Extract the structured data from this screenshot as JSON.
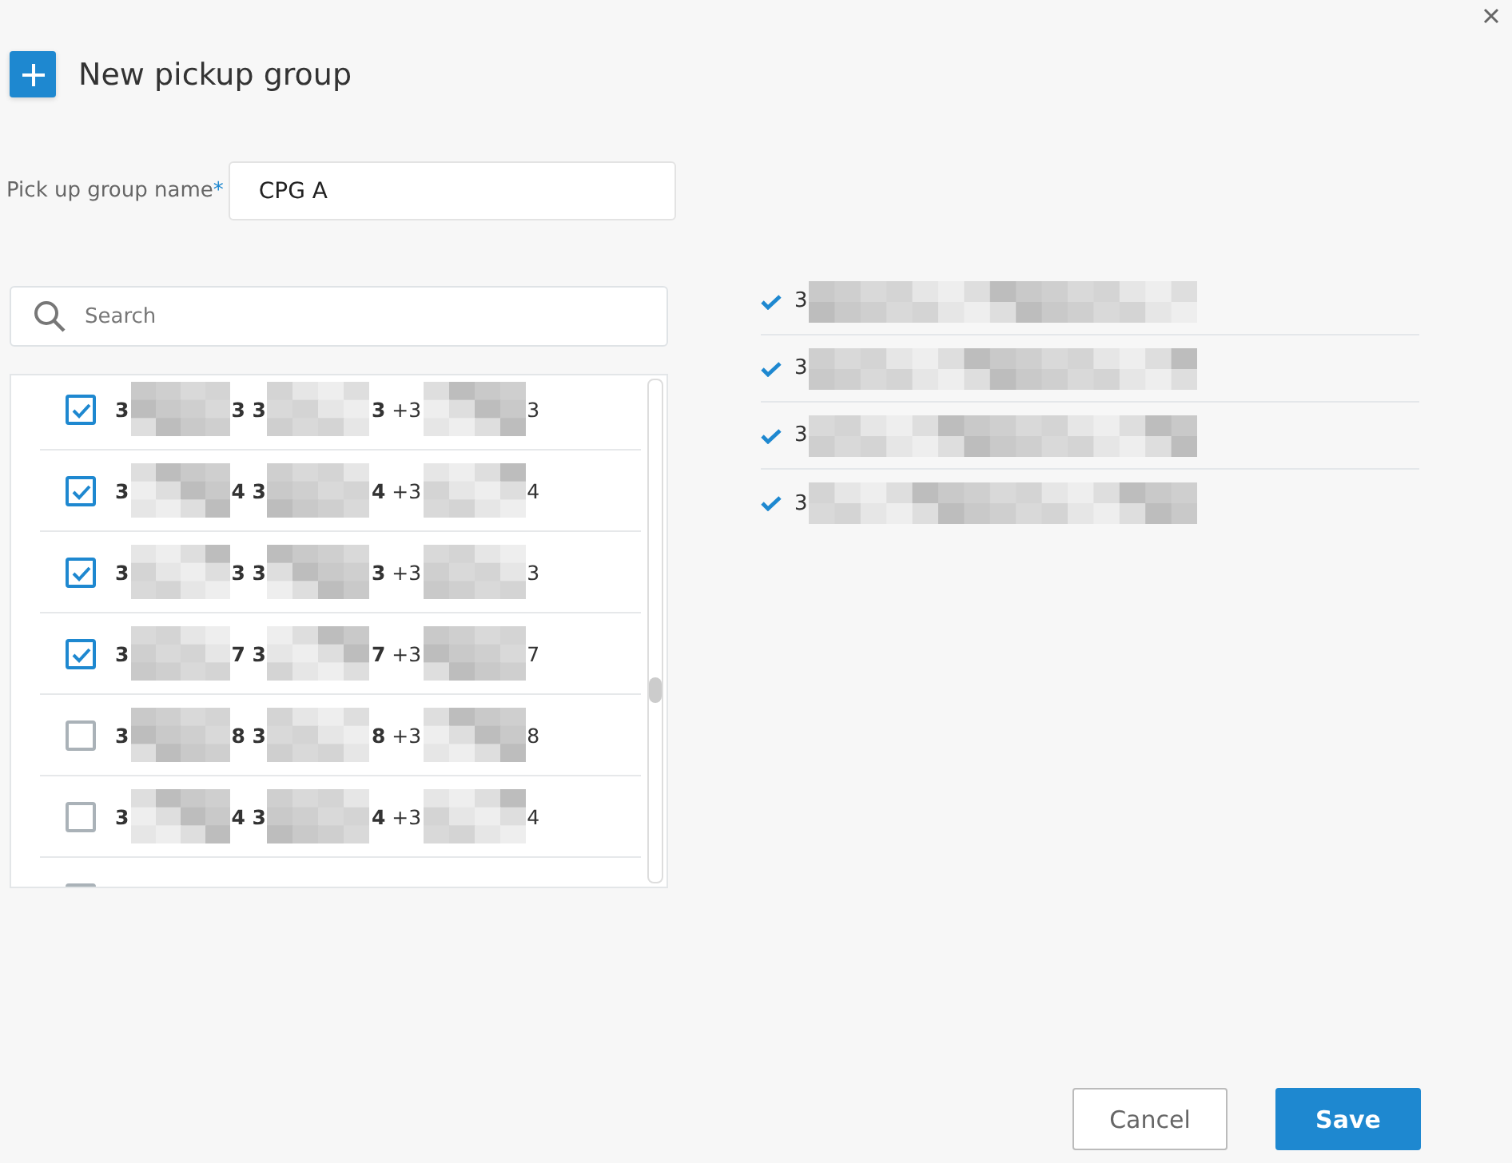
{
  "dialog": {
    "title": "New pickup group"
  },
  "name_field": {
    "label": "Pick up group name",
    "required_mark": "*",
    "value": "CPG A"
  },
  "search": {
    "placeholder": "Search"
  },
  "options": [
    {
      "checked": true,
      "parts": [
        "**3**",
        "**3 3**",
        "**3** +3",
        "3"
      ]
    },
    {
      "checked": true,
      "parts": [
        "**3**",
        "**4 3**",
        "**4** +3",
        "4"
      ]
    },
    {
      "checked": true,
      "parts": [
        "**3**",
        "**3 3**",
        "**3** +3",
        "3"
      ]
    },
    {
      "checked": true,
      "parts": [
        "**3**",
        "**7 3**",
        "**7** +3",
        "7"
      ]
    },
    {
      "checked": false,
      "parts": [
        "**3**",
        "**8 3**",
        "**8** +3",
        "8"
      ]
    },
    {
      "checked": false,
      "parts": [
        "**3**",
        "**4 3**",
        "**4** +3",
        "4"
      ]
    },
    {
      "checked": false
    }
  ],
  "selected_items": [
    {
      "text": "3"
    },
    {
      "text": "3"
    },
    {
      "text": "3"
    },
    {
      "text": "3"
    }
  ],
  "buttons": [
    {
      "label": "Cancel",
      "kind": "secondary"
    },
    {
      "label": "Save",
      "kind": "primary"
    }
  ]
}
